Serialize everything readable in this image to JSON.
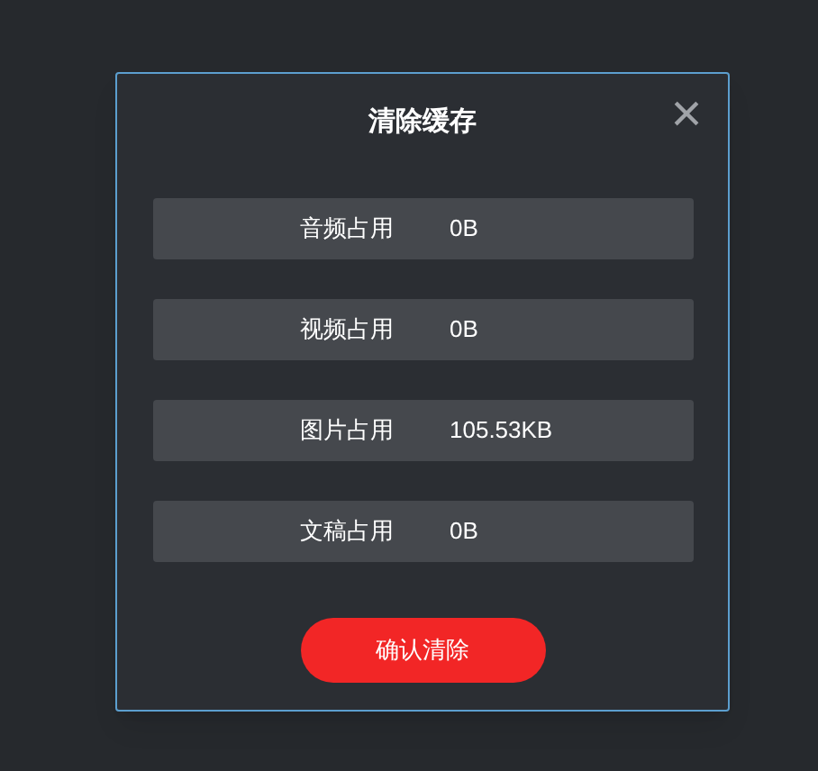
{
  "dialog": {
    "title": "清除缓存",
    "close": "×"
  },
  "items": [
    {
      "label": "音频占用",
      "value": "0B"
    },
    {
      "label": "视频占用",
      "value": "0B"
    },
    {
      "label": "图片占用",
      "value": "105.53KB"
    },
    {
      "label": "文稿占用",
      "value": "0B"
    }
  ],
  "confirm_button": "确认清除"
}
